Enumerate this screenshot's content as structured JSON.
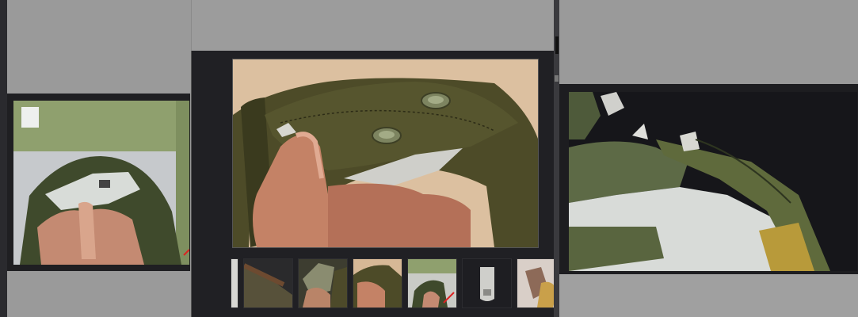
{
  "gallery": {
    "main_image_icon": "canvas-pouch-photo",
    "left_image_icon": "canvas-cover-photo",
    "right_image_icon": "pouch-closeup-photo",
    "thumbnail_count": 7,
    "selected_thumbnail_index": 3
  },
  "colors": {
    "window_bg": "#202024",
    "page_bg": "#9a9a9a",
    "canvas_green": "#4f4e2a",
    "skin": "#c98a70"
  }
}
